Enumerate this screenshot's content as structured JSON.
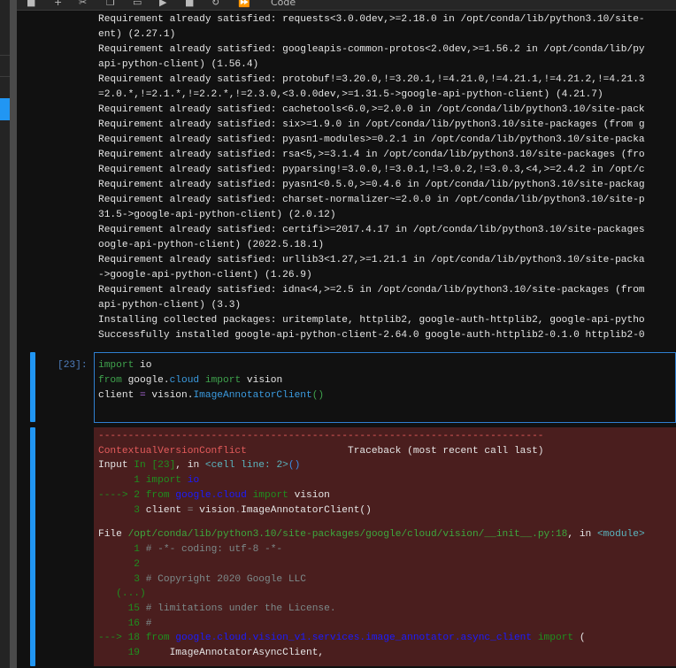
{
  "toolbar": {
    "icons": [
      "save-icon",
      "add-cell-icon",
      "cut-icon",
      "copy-icon",
      "paste-icon",
      "run-icon",
      "stop-icon",
      "restart-icon",
      "fast-forward-icon"
    ],
    "cell_type": "Code"
  },
  "colors": {
    "accent": "#2196f3",
    "error_bg": "#4a1e1e",
    "background": "#111111"
  },
  "output_lines": [
    [
      {
        "t": "Requirement already satisfied: requests<3.0.0dev,>=2.18.0 in /opt/conda/lib/python3.10/site-",
        "c": "w"
      }
    ],
    [
      {
        "t": "ent) (2.27.1)",
        "c": "w"
      }
    ],
    [
      {
        "t": "Requirement already satisfied: googleapis-common-protos<2.0dev,>=1.56.2 in /opt/conda/lib/py",
        "c": "w"
      }
    ],
    [
      {
        "t": "api-python-client) (1.56.4)",
        "c": "w"
      }
    ],
    [
      {
        "t": "Requirement already satisfied: protobuf!=3.20.0,!=3.20.1,!=4.21.0,!=4.21.1,!=4.21.2,!=4.21.3",
        "c": "w"
      }
    ],
    [
      {
        "t": "=2.0.*,!=2.1.*,!=2.2.*,!=2.3.0,<3.0.0dev,>=1.31.5->google-api-python-client) (4.21.7)",
        "c": "w"
      }
    ],
    [
      {
        "t": "Requirement already satisfied: cachetools<6.0,>=2.0.0 in /opt/conda/lib/python3.10/site-pack",
        "c": "w"
      }
    ],
    [
      {
        "t": "Requirement already satisfied: six>=1.9.0 in /opt/conda/lib/python3.10/site-packages (from g",
        "c": "w"
      }
    ],
    [
      {
        "t": "Requirement already satisfied: pyasn1-modules>=0.2.1 in /opt/conda/lib/python3.10/site-packa",
        "c": "w"
      }
    ],
    [
      {
        "t": "Requirement already satisfied: rsa<5,>=3.1.4 in /opt/conda/lib/python3.10/site-packages (fro",
        "c": "w"
      }
    ],
    [
      {
        "t": "Requirement already satisfied: pyparsing!=3.0.0,!=3.0.1,!=3.0.2,!=3.0.3,<4,>=2.4.2 in /opt/c",
        "c": "w"
      }
    ],
    [
      {
        "t": "Requirement already satisfied: pyasn1<0.5.0,>=0.4.6 in /opt/conda/lib/python3.10/site-packag",
        "c": "w"
      }
    ],
    [
      {
        "t": "Requirement already satisfied: charset-normalizer~=2.0.0 in /opt/conda/lib/python3.10/site-p",
        "c": "w"
      }
    ],
    [
      {
        "t": "31.5->google-api-python-client) (2.0.12)",
        "c": "w"
      }
    ],
    [
      {
        "t": "Requirement already satisfied: certifi>=2017.4.17 in /opt/conda/lib/python3.10/site-packages",
        "c": "w"
      }
    ],
    [
      {
        "t": "oogle-api-python-client) (2022.5.18.1)",
        "c": "w"
      }
    ],
    [
      {
        "t": "Requirement already satisfied: urllib3<1.27,>=1.21.1 in /opt/conda/lib/python3.10/site-packa",
        "c": "w"
      }
    ],
    [
      {
        "t": "->google-api-python-client) (1.26.9)",
        "c": "w"
      }
    ],
    [
      {
        "t": "Requirement already satisfied: idna<4,>=2.5 in /opt/conda/lib/python3.10/site-packages (from",
        "c": "w"
      }
    ],
    [
      {
        "t": "api-python-client) (3.3)",
        "c": "w"
      }
    ],
    [
      {
        "t": "Installing collected packages: uritemplate, httplib2, google-auth-httplib2, google-api-pytho",
        "c": "w"
      }
    ],
    [
      {
        "t": "Successfully installed google-api-python-client-2.64.0 google-auth-httplib2-0.1.0 httplib2-0",
        "c": "w"
      }
    ]
  ],
  "input_cell": {
    "prompt": "[23]:",
    "code_lines": [
      [
        {
          "t": "import",
          "c": "kw"
        },
        {
          "t": " io",
          "c": "w"
        }
      ],
      [
        {
          "t": "from",
          "c": "kw"
        },
        {
          "t": " google.",
          "c": "w"
        },
        {
          "t": "cloud",
          "c": "bl"
        },
        {
          "t": " ",
          "c": "w"
        },
        {
          "t": "import",
          "c": "kw"
        },
        {
          "t": " vision",
          "c": "w"
        }
      ],
      [
        {
          "t": "client ",
          "c": "w"
        },
        {
          "t": "=",
          "c": "op"
        },
        {
          "t": " vision.",
          "c": "w"
        },
        {
          "t": "ImageAnnotatorClient",
          "c": "bl"
        },
        {
          "t": "()",
          "c": "gp"
        }
      ]
    ]
  },
  "error_output": [
    [
      {
        "t": "---------------------------------------------------------------------------",
        "c": "red"
      }
    ],
    [
      {
        "t": "ContextualVersionConflict",
        "c": "red"
      },
      {
        "t": "                 Traceback (most recent call last)",
        "c": "w"
      }
    ],
    [
      {
        "t": "Input ",
        "c": "w"
      },
      {
        "t": "In [23]",
        "c": "g"
      },
      {
        "t": ", in ",
        "c": "w"
      },
      {
        "t": "<cell line: 2>",
        "c": "cy"
      },
      {
        "t": "()",
        "c": "pb"
      }
    ],
    [
      {
        "t": "      1 ",
        "c": "g"
      },
      {
        "t": "import",
        "c": "g"
      },
      {
        "t": " ",
        "c": "w"
      },
      {
        "t": "io",
        "c": "b"
      }
    ],
    [
      {
        "t": "----> 2 ",
        "c": "g"
      },
      {
        "t": "from",
        "c": "g"
      },
      {
        "t": " ",
        "c": "w"
      },
      {
        "t": "google.cloud",
        "c": "b"
      },
      {
        "t": " ",
        "c": "w"
      },
      {
        "t": "import",
        "c": "g"
      },
      {
        "t": " vision",
        "c": "w"
      }
    ],
    [
      {
        "t": "      3 ",
        "c": "g"
      },
      {
        "t": "client ",
        "c": "w"
      },
      {
        "t": "=",
        "c": "dim"
      },
      {
        "t": " vision",
        "c": "w"
      },
      {
        "t": ".",
        "c": "dim"
      },
      {
        "t": "ImageAnnotatorClient()",
        "c": "w"
      }
    ],
    [
      {
        "t": "",
        "c": "w"
      }
    ],
    [
      {
        "t": "File ",
        "c": "w"
      },
      {
        "t": "/opt/conda/lib/python3.10/site-packages/google/cloud/vision/__init__.py:18",
        "c": "fp"
      },
      {
        "t": ", in ",
        "c": "w"
      },
      {
        "t": "<module>",
        "c": "cy"
      }
    ],
    [
      {
        "t": "      1 ",
        "c": "g"
      },
      {
        "t": "# -*- coding: utf-8 -*-",
        "c": "c"
      }
    ],
    [
      {
        "t": "      2",
        "c": "g"
      }
    ],
    [
      {
        "t": "      3 ",
        "c": "g"
      },
      {
        "t": "# Copyright 2020 Google LLC",
        "c": "c"
      }
    ],
    [
      {
        "t": "   (...)",
        "c": "g"
      }
    ],
    [
      {
        "t": "     15 ",
        "c": "g"
      },
      {
        "t": "# limitations under the License.",
        "c": "c"
      }
    ],
    [
      {
        "t": "     16 ",
        "c": "g"
      },
      {
        "t": "#",
        "c": "c"
      }
    ],
    [
      {
        "t": "---> 18 ",
        "c": "g"
      },
      {
        "t": "from",
        "c": "g"
      },
      {
        "t": " ",
        "c": "w"
      },
      {
        "t": "google.cloud.vision_v1.services.image_annotator.async_client",
        "c": "b"
      },
      {
        "t": " ",
        "c": "w"
      },
      {
        "t": "import",
        "c": "g"
      },
      {
        "t": " (",
        "c": "w"
      }
    ],
    [
      {
        "t": "     19 ",
        "c": "g"
      },
      {
        "t": "    ImageAnnotatorAsyncClient,",
        "c": "w"
      }
    ]
  ]
}
